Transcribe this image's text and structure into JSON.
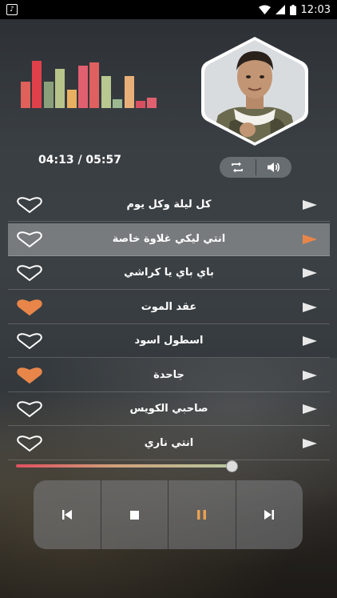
{
  "status": {
    "time": "12:03"
  },
  "equalizer": {
    "bars": [
      {
        "level": 0.55,
        "color": "#e0605a"
      },
      {
        "level": 0.98,
        "color": "#e0404a"
      },
      {
        "level": 0.55,
        "color": "#8aa07a"
      },
      {
        "level": 0.82,
        "color": "#b7c48a"
      },
      {
        "level": 0.38,
        "color": "#e8b060"
      },
      {
        "level": 0.88,
        "color": "#e06070"
      },
      {
        "level": 0.95,
        "color": "#e06060"
      },
      {
        "level": 0.66,
        "color": "#b8c890"
      },
      {
        "level": 0.18,
        "color": "#9cb890"
      },
      {
        "level": 0.66,
        "color": "#e8b078"
      },
      {
        "level": 0.15,
        "color": "#d85060"
      },
      {
        "level": 0.22,
        "color": "#e06070"
      }
    ]
  },
  "player": {
    "time_display": "04:13 / 05:57",
    "progress": 0.73
  },
  "songs": [
    {
      "title": "كل ليلة وكل يوم",
      "favorite": false,
      "active": false
    },
    {
      "title": "انتي ليكي غلاوة خاصة",
      "favorite": false,
      "active": true
    },
    {
      "title": "باي باي يا كراشي",
      "favorite": false,
      "active": false
    },
    {
      "title": "عقد الموت",
      "favorite": true,
      "active": false
    },
    {
      "title": "اسطول اسود",
      "favorite": false,
      "active": false
    },
    {
      "title": "جاحدة",
      "favorite": true,
      "active": false
    },
    {
      "title": "صاحبي الكويس",
      "favorite": false,
      "active": false
    },
    {
      "title": "انتي ناري",
      "favorite": false,
      "active": false
    }
  ],
  "icons": {
    "repeat": "repeat-icon",
    "volume": "volume-icon",
    "prev": "skip-previous-icon",
    "stop": "stop-icon",
    "pause": "pause-icon",
    "next": "skip-next-icon",
    "heart": "heart-icon",
    "play": "play-icon"
  },
  "colors": {
    "accent": "#e8864a",
    "favorite": "#e8864a",
    "pause": "#e8a050"
  }
}
